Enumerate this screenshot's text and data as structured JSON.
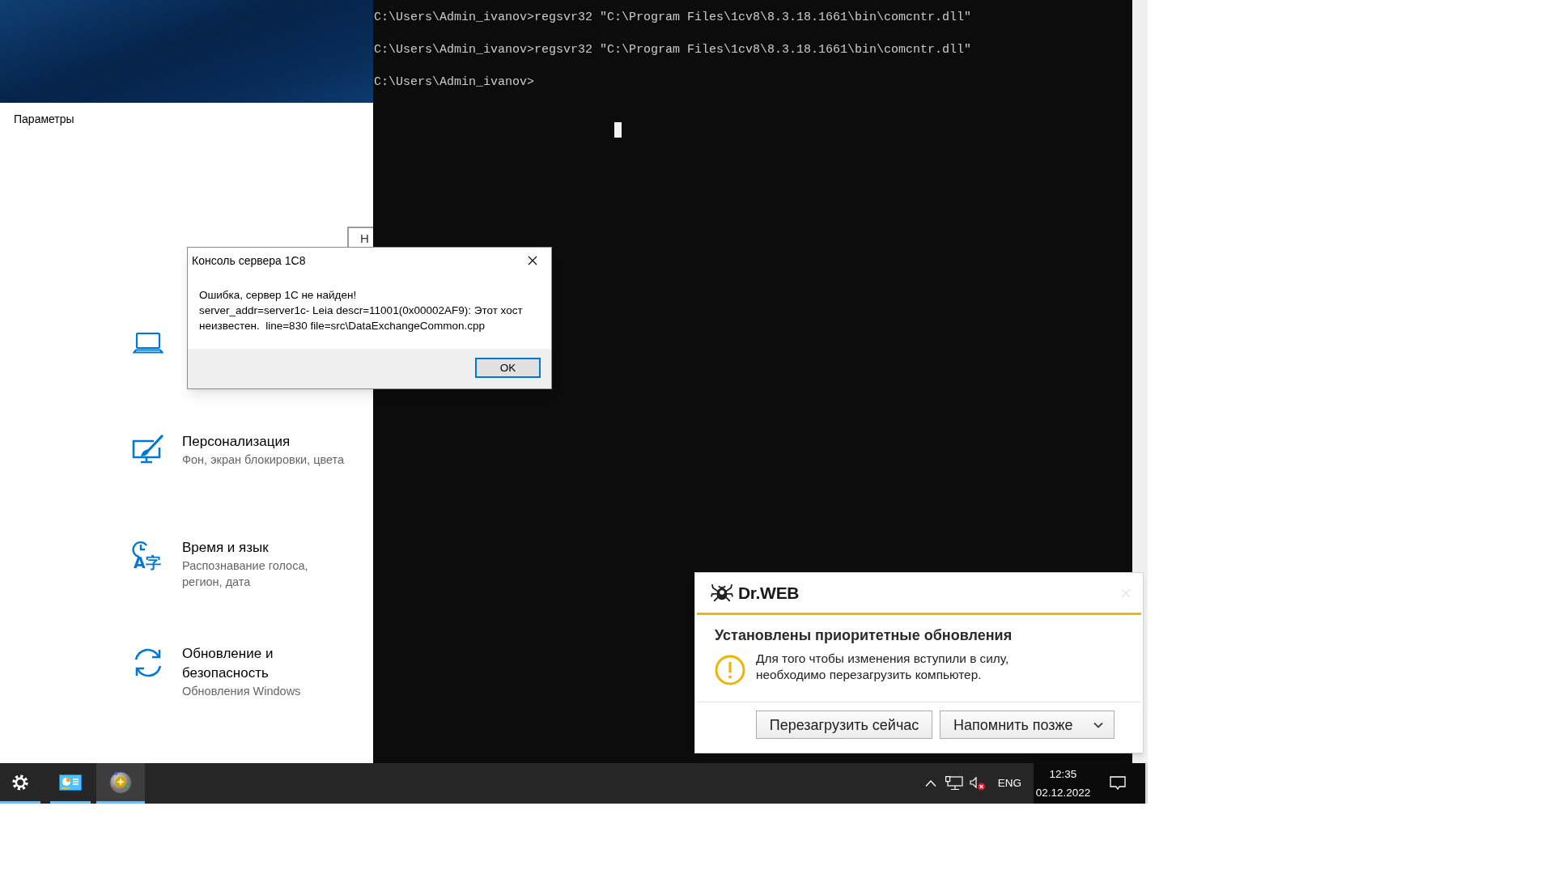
{
  "settings": {
    "title": "Параметры",
    "covered_button": "Н",
    "items": [
      {
        "title": "Персонализация",
        "subtitle": "Фон, экран блокировки, цвета"
      },
      {
        "title": "Время и язык",
        "subtitle": "Распознавание голоса, регион, дата",
        "icon_text": "A字"
      },
      {
        "title": "Обновление и безопасность",
        "subtitle": "Обновления Windows"
      }
    ]
  },
  "terminal": {
    "lines": [
      "C:\\Users\\Admin_ivanov>regsvr32 \"C:\\Program Files\\1cv8\\8.3.18.1661\\bin\\comcntr.dll\"",
      "C:\\Users\\Admin_ivanov>regsvr32 \"C:\\Program Files\\1cv8\\8.3.18.1661\\bin\\comcntr.dll\"",
      "C:\\Users\\Admin_ivanov>"
    ]
  },
  "dialog": {
    "title": "Консоль сервера 1С8",
    "message": "Ошибка, сервер 1С не найден!",
    "details": "server_addr=server1c- Leia descr=11001(0x00002AF9): Этот хост неизвестен.  line=830 file=src\\DataExchangeCommon.cpp",
    "buttons": [
      {
        "label": "OK",
        "default": true
      }
    ]
  },
  "drweb_popup": {
    "brand": "Dr.WEB",
    "heading": "Установлены приоритетные обновления",
    "message": "Для того чтобы изменения вступили в силу, необходимо перезагрузить компьютер.",
    "buttons": [
      {
        "label": "Перезагрузить сейчас",
        "kind": "plain"
      },
      {
        "label": "Напомнить позже",
        "kind": "split"
      }
    ]
  },
  "taskbar": {
    "apps": [
      {
        "selected": false,
        "running": true
      },
      {
        "selected": false,
        "running": true
      },
      {
        "selected": true,
        "running": true
      }
    ],
    "tray": {
      "language": "ENG",
      "time": "12:35",
      "date": "02.12.2022"
    }
  }
}
